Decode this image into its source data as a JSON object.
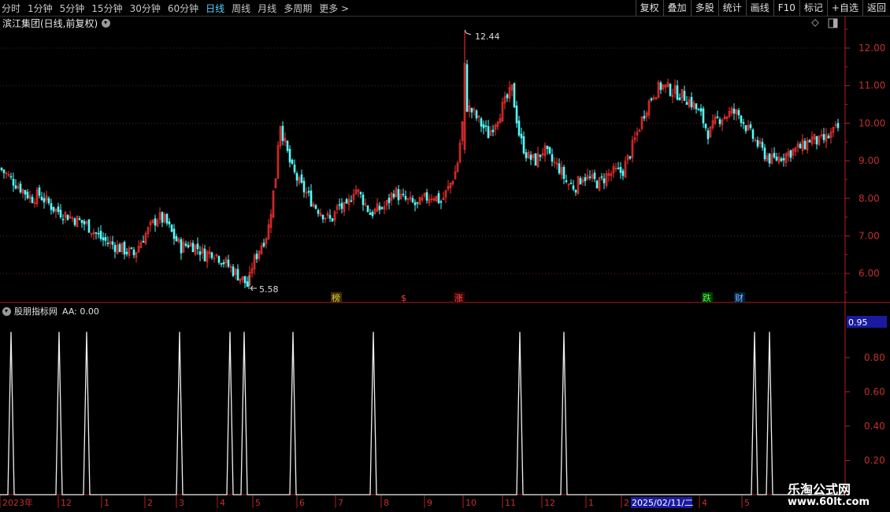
{
  "toolbar": {
    "periods": [
      "分时",
      "1分钟",
      "5分钟",
      "15分钟",
      "30分钟",
      "60分钟",
      "日线",
      "周线",
      "月线",
      "多周期",
      "更多 >"
    ],
    "active_period": "日线",
    "actions": [
      "复权",
      "叠加",
      "多股",
      "统计",
      "画线",
      "F10",
      "标记",
      "+自选",
      "返回"
    ]
  },
  "stock_title": "滨江集团(日线,前复权)",
  "indicator": {
    "name": "股朋指标网",
    "value_text": "AA: 0.00"
  },
  "price_axis": {
    "labels": [
      "12.00",
      "11.00",
      "10.00",
      "9.00",
      "8.00",
      "7.00",
      "6.00"
    ],
    "values": [
      12,
      11,
      10,
      9,
      8,
      7,
      6
    ]
  },
  "indicator_axis": {
    "labels": [
      "0.80",
      "0.60",
      "0.40",
      "0.20"
    ],
    "values": [
      0.8,
      0.6,
      0.4,
      0.2
    ],
    "highlight": "0.95"
  },
  "annotations": {
    "high": "12.44",
    "low": "5.58"
  },
  "event_markers": [
    {
      "label": "榜",
      "color": "#e6c845",
      "bg": "#3a3000"
    },
    {
      "label": "$",
      "color": "#ff4040",
      "bg": "#000"
    },
    {
      "label": "涨",
      "color": "#ff5050",
      "bg": "#3a0000"
    },
    {
      "label": "跌",
      "color": "#50ff50",
      "bg": "#003a00"
    },
    {
      "label": "财",
      "color": "#80c0ff",
      "bg": "#002040"
    }
  ],
  "date_axis": {
    "labels": [
      "2023年",
      "12",
      "1",
      "2",
      "3",
      "4",
      "5",
      "6",
      "7",
      "8",
      "9",
      "10",
      "11",
      "12",
      "1",
      "2",
      "4",
      "5"
    ],
    "cursor_label": "2025/02/11/二"
  },
  "watermark": {
    "line1": "乐淘公式网",
    "line2": "www.60lt.com"
  },
  "chart_data": {
    "type": "candlestick",
    "price_range": [
      5.3,
      12.6
    ],
    "close_trend": [
      [
        0,
        8.8
      ],
      [
        10,
        8.6
      ],
      [
        20,
        8.4
      ],
      [
        30,
        8.2
      ],
      [
        40,
        8.0
      ],
      [
        50,
        8.1
      ],
      [
        60,
        7.9
      ],
      [
        70,
        7.7
      ],
      [
        80,
        7.6
      ],
      [
        90,
        7.5
      ],
      [
        100,
        7.4
      ],
      [
        110,
        7.3
      ],
      [
        120,
        7.1
      ],
      [
        130,
        6.9
      ],
      [
        140,
        6.8
      ],
      [
        150,
        6.7
      ],
      [
        160,
        6.6
      ],
      [
        170,
        6.5
      ],
      [
        180,
        6.9
      ],
      [
        190,
        7.2
      ],
      [
        200,
        7.5
      ],
      [
        210,
        7.4
      ],
      [
        220,
        7.0
      ],
      [
        230,
        6.7
      ],
      [
        240,
        6.8
      ],
      [
        250,
        6.7
      ],
      [
        260,
        6.5
      ],
      [
        270,
        6.6
      ],
      [
        280,
        6.4
      ],
      [
        290,
        6.2
      ],
      [
        300,
        6.0
      ],
      [
        310,
        5.8
      ],
      [
        315,
        5.65
      ],
      [
        320,
        6.2
      ],
      [
        330,
        6.7
      ],
      [
        340,
        7.1
      ],
      [
        350,
        8.6
      ],
      [
        355,
        10.1
      ],
      [
        360,
        9.6
      ],
      [
        370,
        8.8
      ],
      [
        380,
        8.4
      ],
      [
        390,
        8.1
      ],
      [
        400,
        7.8
      ],
      [
        410,
        7.6
      ],
      [
        420,
        7.4
      ],
      [
        430,
        7.8
      ],
      [
        440,
        7.7
      ],
      [
        450,
        8.3
      ],
      [
        460,
        8.0
      ],
      [
        470,
        7.6
      ],
      [
        480,
        7.7
      ],
      [
        490,
        7.8
      ],
      [
        500,
        8.2
      ],
      [
        510,
        8.0
      ],
      [
        520,
        7.9
      ],
      [
        530,
        7.8
      ],
      [
        540,
        8.0
      ],
      [
        550,
        8.1
      ],
      [
        560,
        7.9
      ],
      [
        570,
        8.3
      ],
      [
        580,
        8.8
      ],
      [
        590,
        10.5
      ],
      [
        600,
        10.3
      ],
      [
        610,
        10.0
      ],
      [
        620,
        9.7
      ],
      [
        630,
        10.1
      ],
      [
        640,
        10.5
      ],
      [
        650,
        10.9
      ],
      [
        660,
        9.6
      ],
      [
        670,
        9.1
      ],
      [
        680,
        9.0
      ],
      [
        690,
        9.3
      ],
      [
        700,
        9.0
      ],
      [
        710,
        8.8
      ],
      [
        720,
        8.4
      ],
      [
        730,
        8.3
      ],
      [
        740,
        8.6
      ],
      [
        750,
        8.5
      ],
      [
        760,
        8.4
      ],
      [
        770,
        8.6
      ],
      [
        780,
        8.7
      ],
      [
        790,
        8.7
      ],
      [
        800,
        9.2
      ],
      [
        810,
        9.8
      ],
      [
        820,
        10.4
      ],
      [
        830,
        10.8
      ],
      [
        840,
        11.0
      ],
      [
        850,
        10.9
      ],
      [
        860,
        10.8
      ],
      [
        870,
        10.7
      ],
      [
        880,
        10.5
      ],
      [
        890,
        10.2
      ],
      [
        900,
        9.7
      ],
      [
        910,
        10.1
      ],
      [
        920,
        10.2
      ],
      [
        930,
        10.3
      ],
      [
        940,
        10.2
      ],
      [
        950,
        9.8
      ],
      [
        960,
        9.5
      ],
      [
        970,
        9.2
      ],
      [
        980,
        9.0
      ],
      [
        990,
        9.1
      ],
      [
        1000,
        9.2
      ],
      [
        1010,
        9.3
      ],
      [
        1020,
        9.4
      ],
      [
        1030,
        9.6
      ],
      [
        1040,
        9.5
      ],
      [
        1050,
        9.6
      ],
      [
        1060,
        9.8
      ],
      [
        1066,
        9.9
      ]
    ],
    "indicator_spikes": [
      14,
      75,
      110,
      228,
      292,
      310,
      372,
      474,
      660,
      716,
      958,
      977
    ],
    "indicator_max": 0.95
  }
}
